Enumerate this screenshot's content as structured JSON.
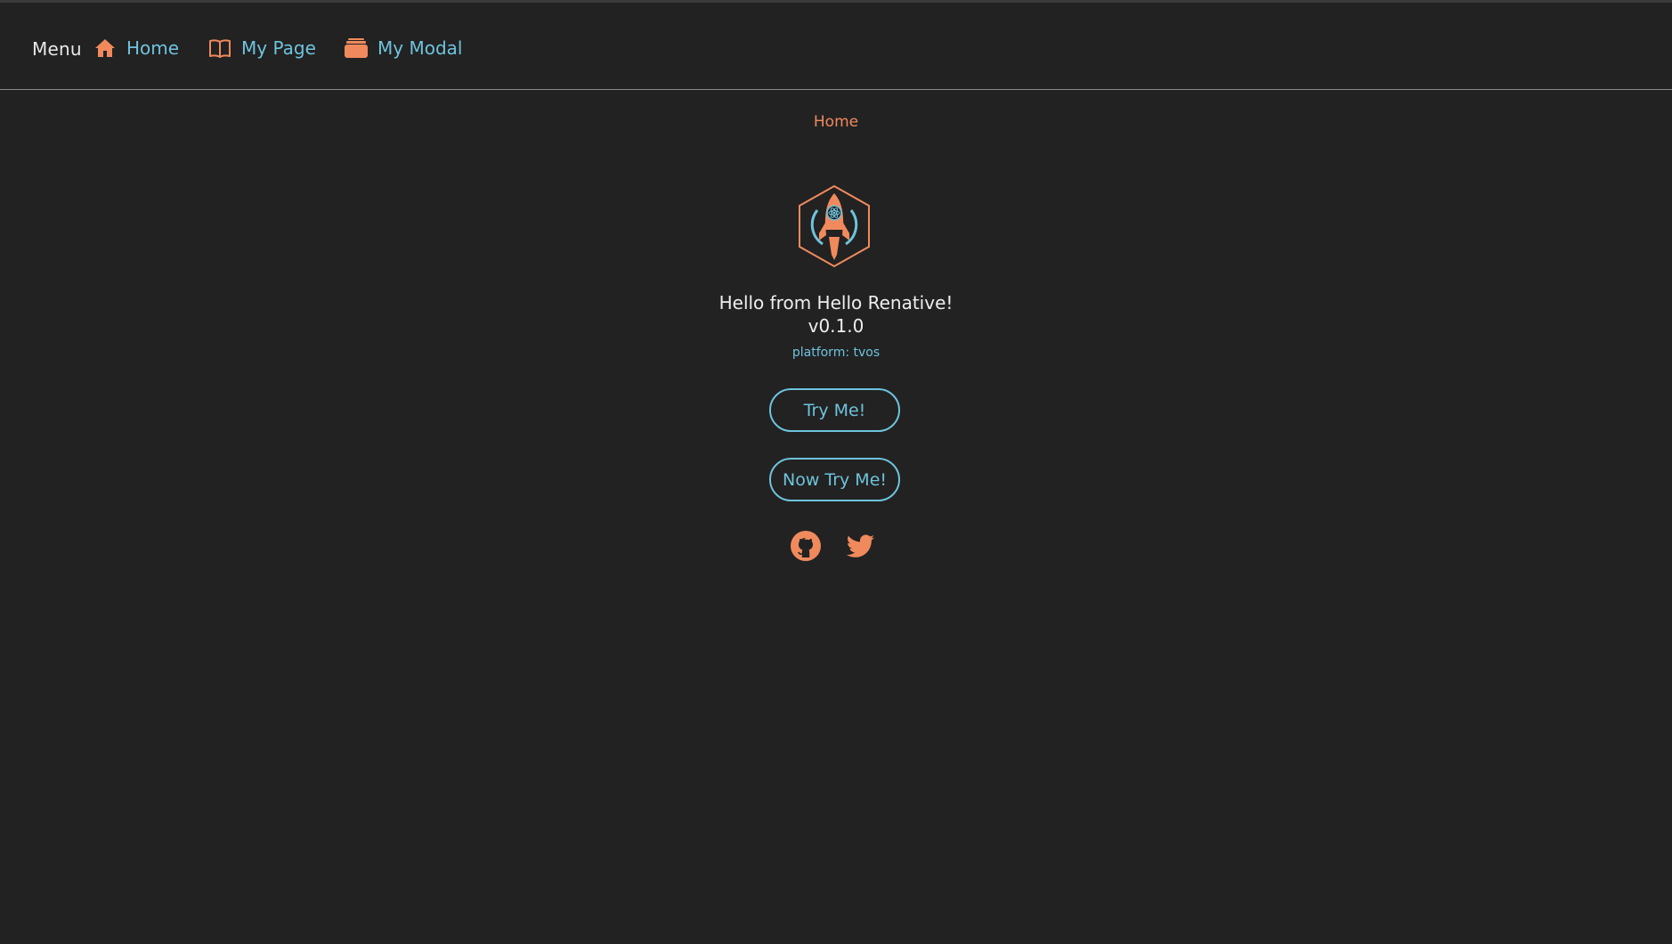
{
  "nav": {
    "menu_label": "Menu",
    "items": [
      {
        "label": "Home",
        "icon": "home-icon"
      },
      {
        "label": "My Page",
        "icon": "book-icon"
      },
      {
        "label": "My Modal",
        "icon": "layers-icon"
      }
    ]
  },
  "main": {
    "breadcrumb": "Home",
    "logo_icon": "rocket-hexagon-logo",
    "title": "Hello from Hello Renative!",
    "version": "v0.1.0",
    "platform": "platform: tvos",
    "buttons": [
      "Try Me!",
      "Now Try Me!"
    ],
    "social": [
      "github-icon",
      "twitter-icon"
    ]
  },
  "colors": {
    "background": "#222222",
    "accent_orange": "#f08a5d",
    "accent_blue": "#6ec3dd",
    "text": "#eeeeee"
  }
}
